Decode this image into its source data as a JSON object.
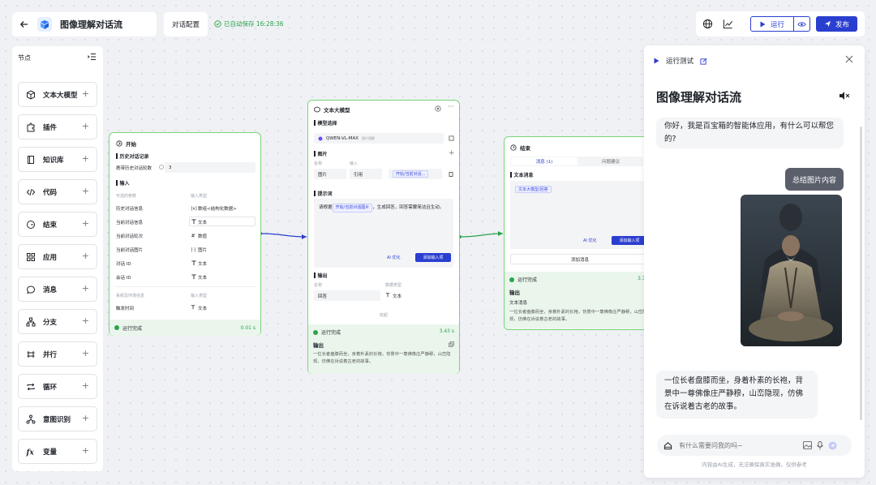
{
  "app": {
    "title": "图像理解对话流",
    "config_tab": "对话配置",
    "autosave": "已自动保存 16:28:36"
  },
  "toolbar": {
    "run_label": "运行",
    "publish_label": "发布"
  },
  "sidebar": {
    "title": "节点",
    "items": [
      {
        "label": "文本大模型",
        "icon": "cube-icon"
      },
      {
        "label": "插件",
        "icon": "puzzle-icon"
      },
      {
        "label": "知识库",
        "icon": "book-icon"
      },
      {
        "label": "代码",
        "icon": "code-icon"
      },
      {
        "label": "结束",
        "icon": "end-icon"
      },
      {
        "label": "应用",
        "icon": "grid-icon"
      },
      {
        "label": "消息",
        "icon": "message-icon"
      },
      {
        "label": "分支",
        "icon": "branch-icon"
      },
      {
        "label": "并行",
        "icon": "parallel-icon"
      },
      {
        "label": "循环",
        "icon": "loop-icon"
      },
      {
        "label": "意图识别",
        "icon": "intent-icon"
      },
      {
        "label": "变量",
        "icon": "fx-icon"
      }
    ]
  },
  "start_node": {
    "title": "开始",
    "history_section": "历史对话记录",
    "history_label": "携带历史对话轮数",
    "history_value": "3",
    "input_section": "输入",
    "col_var": "可选的参数",
    "col_type": "输入类型",
    "rows": [
      {
        "name": "历史对话信息",
        "type": "数组<结构化数据>"
      },
      {
        "name": "当前对话信息",
        "type": "文本"
      },
      {
        "name": "当前对话轮次",
        "type": "数值"
      },
      {
        "name": "当前对话图片",
        "type": "图片"
      },
      {
        "name": "对话 ID",
        "type": "文本"
      },
      {
        "name": "会话 ID",
        "type": "文本"
      }
    ],
    "col_var2": "系统及环境信息",
    "col_type2": "输入类型",
    "row_time": {
      "name": "触发时间",
      "type": "文本"
    },
    "status": "运行完成",
    "time": "0.01 s"
  },
  "llm_node": {
    "title": "文本大模型",
    "model_section": "模型选择",
    "model": "QWEN-VL-MAX",
    "model_tag": "图片理解",
    "image_section": "图片",
    "col_name": "名称",
    "col_input": "输入",
    "image_name": "图片",
    "image_mode": "引用",
    "image_ref": "开始/当前对话...",
    "prompt_section": "提示词",
    "prompt_pre": "请根据",
    "prompt_ref": "开始/当前对话图片",
    "prompt_post": "，生成回答，回答需要简洁且生动。",
    "ai_opt": "AI 优化",
    "add_input": "添加输入项",
    "output_section": "输出",
    "out_col_name": "名称",
    "out_col_type": "数据类型",
    "out_name": "回答",
    "out_type": "文本",
    "collapse": "收起",
    "status": "运行完成",
    "time": "3.43 s",
    "output_label": "输出",
    "output_text": "一位长者盘膝而坐，身着朴素的长袍，背景中一尊佛像庄严静穆，山峦隐现，仿佛在诉说着古老的故事。"
  },
  "end_node": {
    "title": "结束",
    "tab_msg": "消息 (1)",
    "tab_suggest": "问题建议",
    "msg_section": "文本消息",
    "msg_ref": "文本大模型/回答",
    "ai_opt": "AI 优化",
    "add_input": "添加输入项",
    "add_msg": "添加消息",
    "status": "运行完成",
    "time": "3.3",
    "output_label": "输出",
    "output_sub": "文本消息",
    "output_text": "一位长者盘膝而坐，身着朴素的长袍，背景中一尊佛像庄严静穆，山峦隐现，仿佛在诉说着古老的故事。"
  },
  "run_panel": {
    "header": "运行测试",
    "title": "图像理解对话流",
    "greeting": "你好，我是百宝箱的智能体应用，有什么可以帮您的?",
    "user_msg": "总结图片内容",
    "answer": "一位长者盘膝而坐，身着朴素的长袍，背景中一尊佛像庄严静穆，山峦隐现，仿佛在诉说着古老的故事。",
    "input_placeholder": "有什么需要问我的吗~",
    "disclaimer": "内容由AI生成，无法确保真实准确，仅供参考"
  }
}
